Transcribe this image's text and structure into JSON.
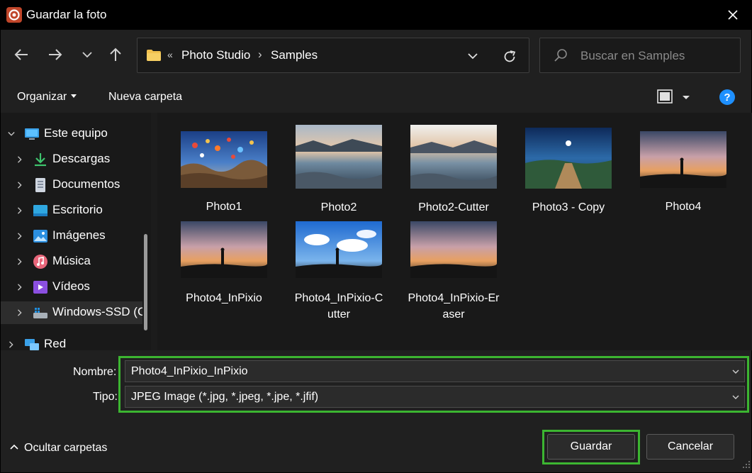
{
  "window": {
    "title": "Guardar la foto"
  },
  "navigation": {
    "breadcrumb_overflow": "«",
    "breadcrumb": [
      "Photo Studio",
      "Samples"
    ],
    "breadcrumb_separator": "›",
    "search_placeholder": "Buscar en Samples"
  },
  "commands": {
    "organize": "Organizar",
    "new_folder": "Nueva carpeta",
    "help": "?"
  },
  "sidebar": {
    "items": [
      {
        "label": "Este equipo",
        "icon": "monitor-icon",
        "expanded": true
      },
      {
        "label": "Descargas",
        "icon": "download-icon"
      },
      {
        "label": "Documentos",
        "icon": "document-icon"
      },
      {
        "label": "Escritorio",
        "icon": "desktop-icon"
      },
      {
        "label": "Imágenes",
        "icon": "image-icon"
      },
      {
        "label": "Música",
        "icon": "music-icon"
      },
      {
        "label": "Vídeos",
        "icon": "video-icon"
      },
      {
        "label": "Windows-SSD (C:)",
        "icon": "drive-icon",
        "selected": true
      },
      {
        "label": "Red",
        "icon": "network-icon"
      }
    ]
  },
  "files": [
    {
      "name": "Photo1"
    },
    {
      "name": "Photo2"
    },
    {
      "name": "Photo2-Cutter"
    },
    {
      "name": "Photo3 - Copy"
    },
    {
      "name": "Photo4"
    },
    {
      "name": "Photo4_InPixio"
    },
    {
      "name": "Photo4_InPixio-C\nutter"
    },
    {
      "name": "Photo4_InPixio-Er\naser"
    }
  ],
  "form": {
    "name_label": "Nombre:",
    "name_value": "Photo4_InPixio_InPixio",
    "type_label": "Tipo:",
    "type_value": "JPEG Image (*.jpg, *.jpeg, *.jpe, *.jfif)"
  },
  "footer": {
    "hide_folders": "Ocultar carpetas",
    "save": "Guardar",
    "cancel": "Cancelar"
  },
  "colors": {
    "highlight_outline": "#3cb531",
    "help_blue": "#1e90ff",
    "folder_yellow": "#f2c14e"
  }
}
